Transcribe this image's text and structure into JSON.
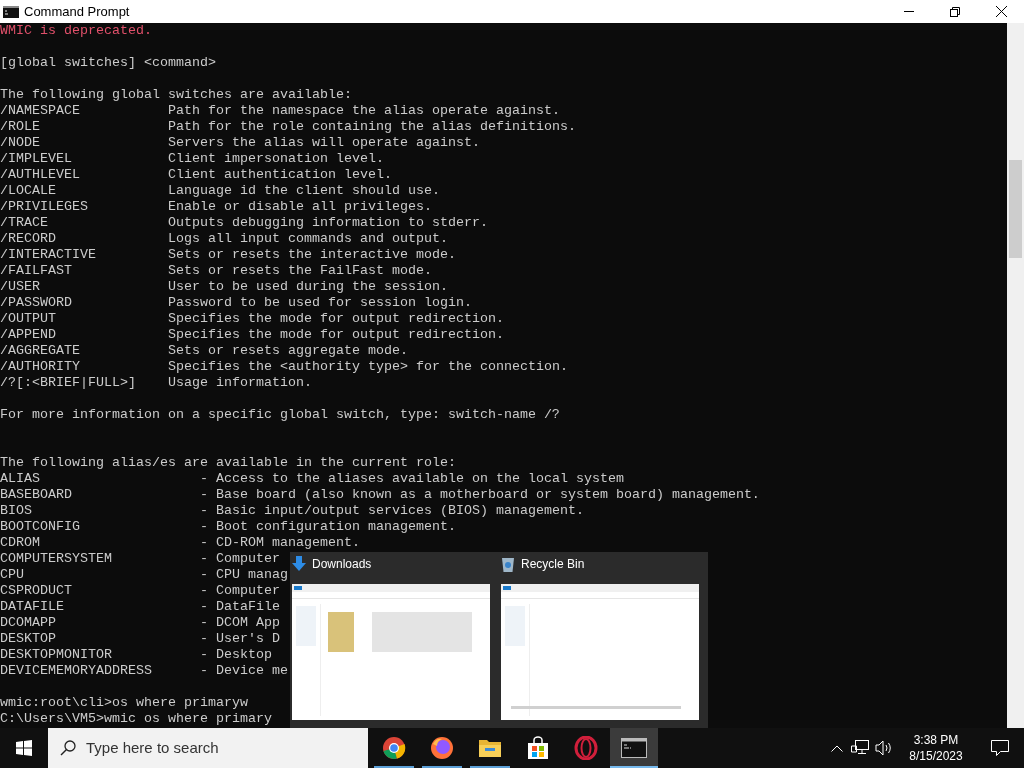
{
  "window": {
    "title": "Command Prompt"
  },
  "console": {
    "lines": [
      {
        "kind": "error",
        "text": "WMIC is deprecated."
      },
      {
        "kind": "blank"
      },
      {
        "kind": "text",
        "text": "[global switches] <command>"
      },
      {
        "kind": "blank"
      },
      {
        "kind": "text",
        "text": "The following global switches are available:"
      },
      {
        "kind": "switch",
        "name": "/NAMESPACE",
        "desc": "Path for the namespace the alias operate against."
      },
      {
        "kind": "switch",
        "name": "/ROLE",
        "desc": "Path for the role containing the alias definitions."
      },
      {
        "kind": "switch",
        "name": "/NODE",
        "desc": "Servers the alias will operate against."
      },
      {
        "kind": "switch",
        "name": "/IMPLEVEL",
        "desc": "Client impersonation level."
      },
      {
        "kind": "switch",
        "name": "/AUTHLEVEL",
        "desc": "Client authentication level."
      },
      {
        "kind": "switch",
        "name": "/LOCALE",
        "desc": "Language id the client should use."
      },
      {
        "kind": "switch",
        "name": "/PRIVILEGES",
        "desc": "Enable or disable all privileges."
      },
      {
        "kind": "switch",
        "name": "/TRACE",
        "desc": "Outputs debugging information to stderr."
      },
      {
        "kind": "switch",
        "name": "/RECORD",
        "desc": "Logs all input commands and output."
      },
      {
        "kind": "switch",
        "name": "/INTERACTIVE",
        "desc": "Sets or resets the interactive mode."
      },
      {
        "kind": "switch",
        "name": "/FAILFAST",
        "desc": "Sets or resets the FailFast mode."
      },
      {
        "kind": "switch",
        "name": "/USER",
        "desc": "User to be used during the session."
      },
      {
        "kind": "switch",
        "name": "/PASSWORD",
        "desc": "Password to be used for session login."
      },
      {
        "kind": "switch",
        "name": "/OUTPUT",
        "desc": "Specifies the mode for output redirection."
      },
      {
        "kind": "switch",
        "name": "/APPEND",
        "desc": "Specifies the mode for output redirection."
      },
      {
        "kind": "switch",
        "name": "/AGGREGATE",
        "desc": "Sets or resets aggregate mode."
      },
      {
        "kind": "switch",
        "name": "/AUTHORITY",
        "desc": "Specifies the <authority type> for the connection."
      },
      {
        "kind": "switch",
        "name": "/?[:<BRIEF|FULL>]",
        "desc": "Usage information."
      },
      {
        "kind": "blank"
      },
      {
        "kind": "text",
        "text": "For more information on a specific global switch, type: switch-name /?"
      },
      {
        "kind": "blank"
      },
      {
        "kind": "blank"
      },
      {
        "kind": "text",
        "text": "The following alias/es are available in the current role:"
      },
      {
        "kind": "alias",
        "name": "ALIAS",
        "desc": "- Access to the aliases available on the local system"
      },
      {
        "kind": "alias",
        "name": "BASEBOARD",
        "desc": "- Base board (also known as a motherboard or system board) management."
      },
      {
        "kind": "alias",
        "name": "BIOS",
        "desc": "- Basic input/output services (BIOS) management."
      },
      {
        "kind": "alias",
        "name": "BOOTCONFIG",
        "desc": "- Boot configuration management."
      },
      {
        "kind": "alias",
        "name": "CDROM",
        "desc": "- CD-ROM management."
      },
      {
        "kind": "alias",
        "name": "COMPUTERSYSTEM",
        "desc": "- Computer"
      },
      {
        "kind": "alias",
        "name": "CPU",
        "desc": "- CPU manag"
      },
      {
        "kind": "alias",
        "name": "CSPRODUCT",
        "desc": "- Computer"
      },
      {
        "kind": "alias",
        "name": "DATAFILE",
        "desc": "- DataFile"
      },
      {
        "kind": "alias",
        "name": "DCOMAPP",
        "desc": "- DCOM App"
      },
      {
        "kind": "alias",
        "name": "DESKTOP",
        "desc": "- User's D"
      },
      {
        "kind": "alias",
        "name": "DESKTOPMONITOR",
        "desc": "- Desktop"
      },
      {
        "kind": "alias",
        "name": "DEVICEMEMORYADDRESS",
        "desc": "- Device me"
      },
      {
        "kind": "blank"
      },
      {
        "kind": "text",
        "text": "wmic:root\\cli>os where primaryw"
      },
      {
        "kind": "text",
        "text": "C:\\Users\\VM5>wmic os where primary"
      }
    ]
  },
  "thumbnail_popup": {
    "items": [
      {
        "kind": "downloads",
        "title": "Downloads"
      },
      {
        "kind": "recycle",
        "title": "Recycle Bin"
      }
    ]
  },
  "taskbar": {
    "search": {
      "placeholder": "Type here to search"
    },
    "apps": [
      {
        "kind": "chrome",
        "open": true,
        "selected": false
      },
      {
        "kind": "firefox",
        "open": true,
        "selected": false
      },
      {
        "kind": "explorer",
        "open": true,
        "selected": false
      },
      {
        "kind": "store",
        "open": false,
        "selected": false
      },
      {
        "kind": "opera",
        "open": false,
        "selected": false
      },
      {
        "kind": "cmd",
        "open": true,
        "selected": true
      }
    ],
    "time": "3:38 PM",
    "date": "8/15/2023"
  }
}
